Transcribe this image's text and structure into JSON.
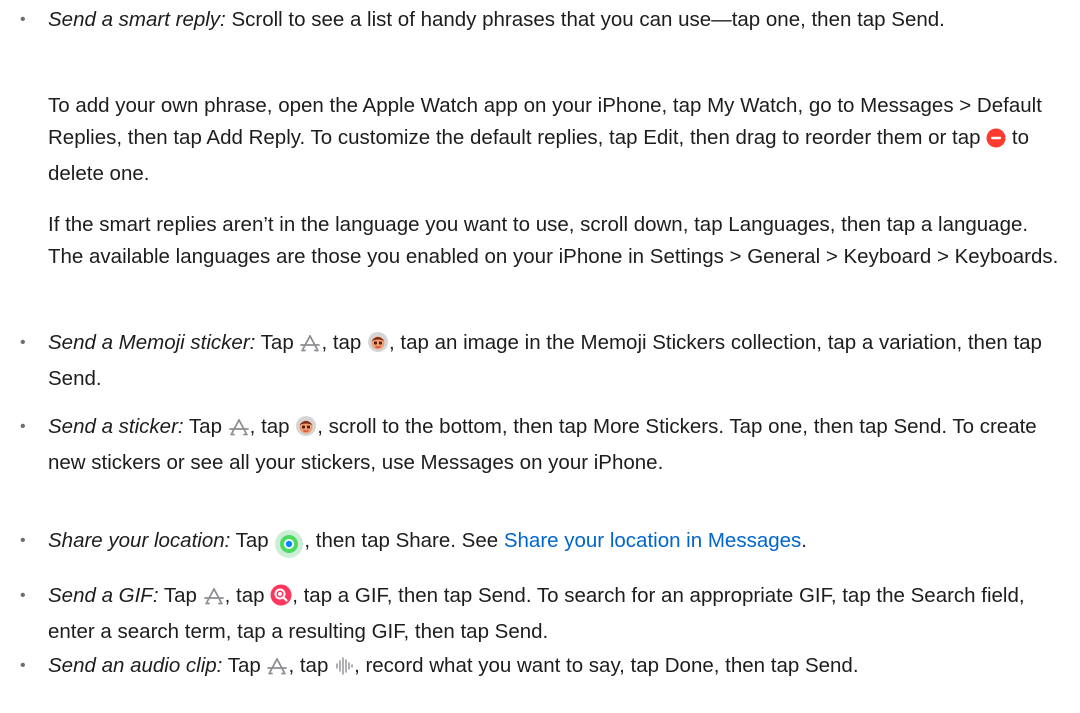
{
  "items": [
    {
      "label": "Send a smart reply:",
      "text": " Scroll to see a list of handy phrases that you can use—tap one, then tap Send."
    },
    {
      "para1_a": "To add your own phrase, open the Apple Watch app on your iPhone, tap My Watch, go to Messages > Default Replies, then tap Add Reply. To customize the default replies, tap Edit, then drag to reorder them or tap ",
      "para1_b": " to delete one.",
      "para2": "If the smart replies aren’t in the language you want to use, scroll down, tap Languages, then tap a language. The available languages are those you enabled on your iPhone in Settings > General > Keyboard > Keyboards."
    },
    {
      "label": "Send a Memoji sticker:",
      "t1": " Tap ",
      "t2": ", tap ",
      "t3": ", tap an image in the Memoji Stickers collection, tap a variation, then tap Send."
    },
    {
      "label": "Send a sticker:",
      "t1": " Tap ",
      "t2": ", tap ",
      "t3": ", scroll to the bottom, then tap More Stickers. Tap one, then tap Send. To create new stickers or see all your stickers, use Messages on your iPhone."
    },
    {
      "label": "Share your location:",
      "t1": " Tap ",
      "t2": ", then tap Share. See ",
      "link": "Share your location in Messages",
      "t3": "."
    },
    {
      "label": "Send a GIF:",
      "t1": " Tap ",
      "t2": ", tap ",
      "t3": ", tap a GIF, then tap Send. To search for an appropriate GIF, tap the Search field, enter a search term, tap a resulting GIF, then tap Send."
    },
    {
      "label": "Send an audio clip:",
      "t1": " Tap ",
      "t2": ", tap ",
      "t3": ", record what you want to say, tap Done, then tap Send."
    }
  ],
  "bullet": "•",
  "colors": {
    "text": "#1d1d1f",
    "link": "#0066cc",
    "delete": "#ff3b30",
    "location": "#34c759",
    "gif": "#ff375f"
  },
  "icons": [
    "delete-icon",
    "app-store-icon",
    "memoji-icon",
    "location-icon",
    "gif-search-icon",
    "audio-waveform-icon"
  ]
}
